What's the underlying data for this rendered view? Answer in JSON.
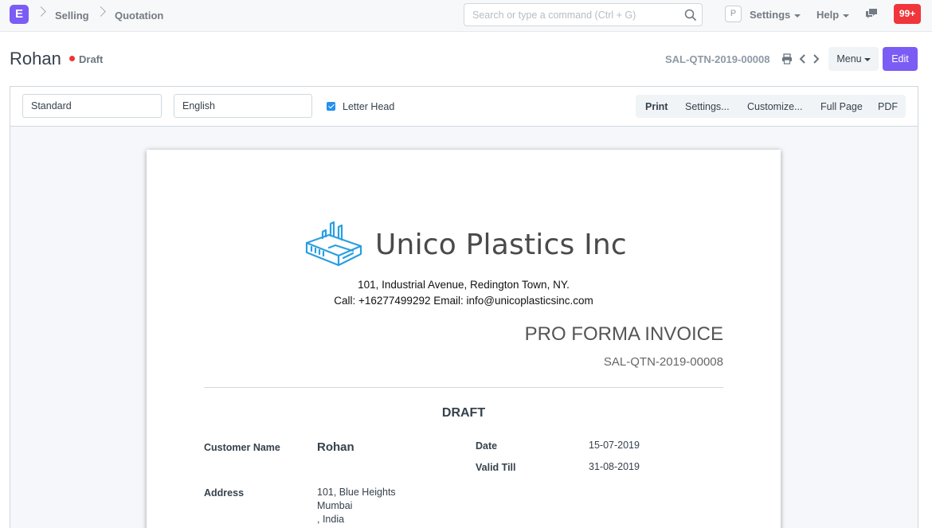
{
  "navbar": {
    "logo_letter": "E",
    "breadcrumbs": [
      "Selling",
      "Quotation"
    ],
    "search_placeholder": "Search or type a command (Ctrl + G)",
    "user_initial": "P",
    "settings_label": "Settings",
    "help_label": "Help",
    "notification_count": "99+"
  },
  "header": {
    "title": "Rohan",
    "status": "Draft",
    "status_color": "#f23333",
    "doc_id": "SAL-QTN-2019-00008",
    "menu_label": "Menu",
    "edit_label": "Edit"
  },
  "toolbar": {
    "print_format": "Standard",
    "language": "English",
    "letter_head_label": "Letter Head",
    "letter_head_checked": true,
    "buttons": [
      "Print",
      "Settings...",
      "Customize...",
      "Full Page",
      "PDF"
    ]
  },
  "document": {
    "company_name": "Unico Plastics Inc",
    "company_address": "101, Industrial Avenue, Redington Town, NY.",
    "company_contact": "Call: +16277499292 Email: info@unicoplasticsinc.com",
    "title": "PRO FORMA INVOICE",
    "doc_id": "SAL-QTN-2019-00008",
    "status_banner": "DRAFT",
    "customer_name_label": "Customer Name",
    "customer_name": "Rohan",
    "date_label": "Date",
    "date": "15-07-2019",
    "valid_till_label": "Valid Till",
    "valid_till": "31-08-2019",
    "address_label": "Address",
    "address_lines": [
      "101, Blue Heights",
      "Mumbai",
      ", India"
    ]
  },
  "colors": {
    "accent": "#7b5cf5",
    "logo_blue": "#2a9fe0",
    "notification_red": "#f0353b"
  }
}
